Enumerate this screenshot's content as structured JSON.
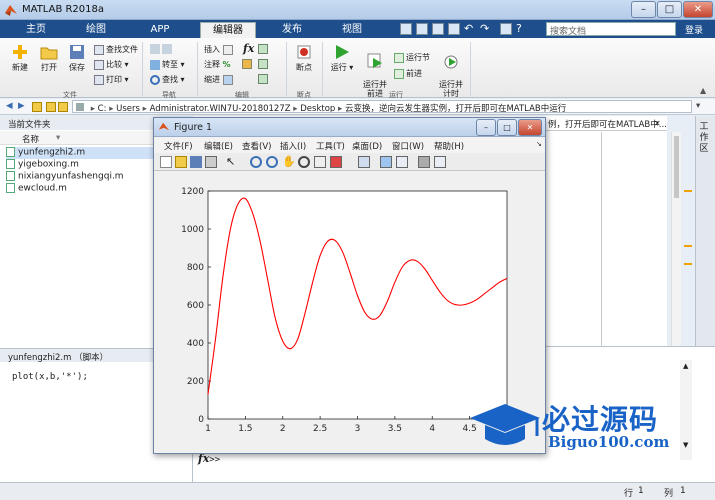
{
  "app": {
    "title": "MATLAB R2018a"
  },
  "window_controls": {
    "minimize": "–",
    "maximize": "□",
    "close": "✕"
  },
  "tabs": [
    {
      "label": "主页",
      "active": false
    },
    {
      "label": "绘图",
      "active": false
    },
    {
      "label": "APP",
      "active": false
    },
    {
      "label": "编辑器",
      "active": true
    },
    {
      "label": "发布",
      "active": false
    },
    {
      "label": "视图",
      "active": false
    }
  ],
  "search": {
    "placeholder": "搜索文档"
  },
  "login": "登录",
  "ribbon": {
    "file": {
      "new": "新建",
      "open": "打开",
      "save": "保存",
      "find_files": "查找文件",
      "compare": "比较",
      "print": "打印",
      "group": "文件"
    },
    "navigate": {
      "goto": "转至",
      "find": "查找",
      "group": "导航"
    },
    "edit": {
      "insert": "插入",
      "comment": "注释",
      "indent": "缩进",
      "fx": "fx",
      "group": "编辑"
    },
    "breakpoints": {
      "label": "断点",
      "group": "断点"
    },
    "run": {
      "run": "运行",
      "run_advance": "运行并\n前进",
      "run_section": "运行节",
      "advance": "前进",
      "run_time": "运行并\n计时",
      "group": "运行"
    }
  },
  "address": {
    "path": [
      "C:",
      "Users",
      "Administrator.WIN7U-20180127Z",
      "Desktop",
      "云变换，逆向云发生器实例，打开后即可在MATLAB中运行"
    ]
  },
  "current_folder": {
    "header": "当前文件夹",
    "column_name": "名称",
    "files": [
      {
        "name": "yunfengzhi2.m",
        "selected": true
      },
      {
        "name": "yigeboxing.m",
        "selected": false
      },
      {
        "name": "nixiangyunfashengqi.m",
        "selected": false
      },
      {
        "name": "ewcloud.m",
        "selected": false
      }
    ]
  },
  "details": {
    "header": "yunfengzhi2.m  （脚本）",
    "code": "plot(x,b,'*');"
  },
  "editor_behind_text": "例，打开后即可在MATLAB中...",
  "workspace_label": "工作区",
  "command": {
    "prompt": ">>",
    "fx": "fx"
  },
  "status": {
    "row_label": "行",
    "row": "1",
    "col_label": "列",
    "col": "1"
  },
  "figure": {
    "title": "Figure 1",
    "menu": [
      "文件(F)",
      "编辑(E)",
      "查看(V)",
      "插入(I)",
      "工具(T)",
      "桌面(D)",
      "窗口(W)",
      "帮助(H)"
    ]
  },
  "chart_data": {
    "type": "line",
    "title": "",
    "xlabel": "",
    "ylabel": "",
    "xlim": [
      1,
      5
    ],
    "ylim": [
      0,
      1200
    ],
    "xticks": [
      "1",
      "1.5",
      "2",
      "2.5",
      "3",
      "3.5",
      "4",
      "4.5",
      "5"
    ],
    "yticks": [
      "0",
      "200",
      "400",
      "600",
      "800",
      "1000",
      "1200"
    ],
    "color": "#ff0000",
    "series": [
      {
        "x": [
          1.0,
          1.1,
          1.2,
          1.3,
          1.4,
          1.5,
          1.6,
          1.7,
          1.8,
          1.9,
          2.0,
          2.1,
          2.2,
          2.3,
          2.4,
          2.5,
          2.6,
          2.7,
          2.8,
          2.9,
          3.0,
          3.1,
          3.2,
          3.3,
          3.4,
          3.5,
          3.6,
          3.7,
          3.8,
          3.9,
          4.0,
          4.1,
          4.2,
          4.3,
          4.4,
          4.5,
          4.6,
          4.7,
          4.8,
          4.9,
          5.0
        ],
        "y": [
          130,
          420,
          750,
          1000,
          1130,
          1160,
          1080,
          930,
          730,
          530,
          410,
          370,
          420,
          560,
          720,
          860,
          935,
          940,
          880,
          770,
          650,
          560,
          525,
          545,
          620,
          720,
          800,
          835,
          830,
          790,
          730,
          670,
          625,
          603,
          600,
          610,
          630,
          660,
          690,
          720,
          740
        ]
      }
    ]
  },
  "watermark": {
    "title": "必过源码",
    "subtitle": "Biguo100.com"
  }
}
